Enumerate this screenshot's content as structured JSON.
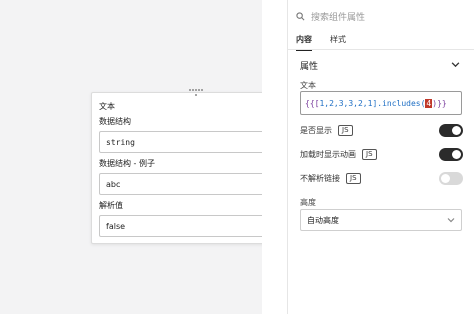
{
  "card": {
    "title": "文本",
    "sections": [
      {
        "label": "数据结构",
        "value": "string"
      },
      {
        "label": "数据结构 - 例子",
        "value": "abc"
      },
      {
        "label": "解析值",
        "value": "false"
      }
    ]
  },
  "panel": {
    "search_placeholder": "搜索组件属性",
    "tabs": [
      {
        "label": "内容",
        "active": true
      },
      {
        "label": "样式",
        "active": false
      }
    ],
    "section_title": "属性",
    "text_field": {
      "label": "文本",
      "code_open": "{{[",
      "code_nums": "1,2,3,3,2,1",
      "code_mid": "].includes(",
      "code_hl": "4",
      "code_close": ")}}"
    },
    "settings": [
      {
        "label": "是否显示",
        "badge": "JS",
        "on": true
      },
      {
        "label": "加载时显示动画",
        "badge": "JS",
        "on": true
      },
      {
        "label": "不解析链接",
        "badge": "JS",
        "on": false
      }
    ],
    "height": {
      "label": "高度",
      "value": "自动高度"
    }
  },
  "colors": {
    "toggle_on": "#2b2b2b",
    "toggle_off": "#d9d9d9",
    "highlight": "#c0392b"
  }
}
